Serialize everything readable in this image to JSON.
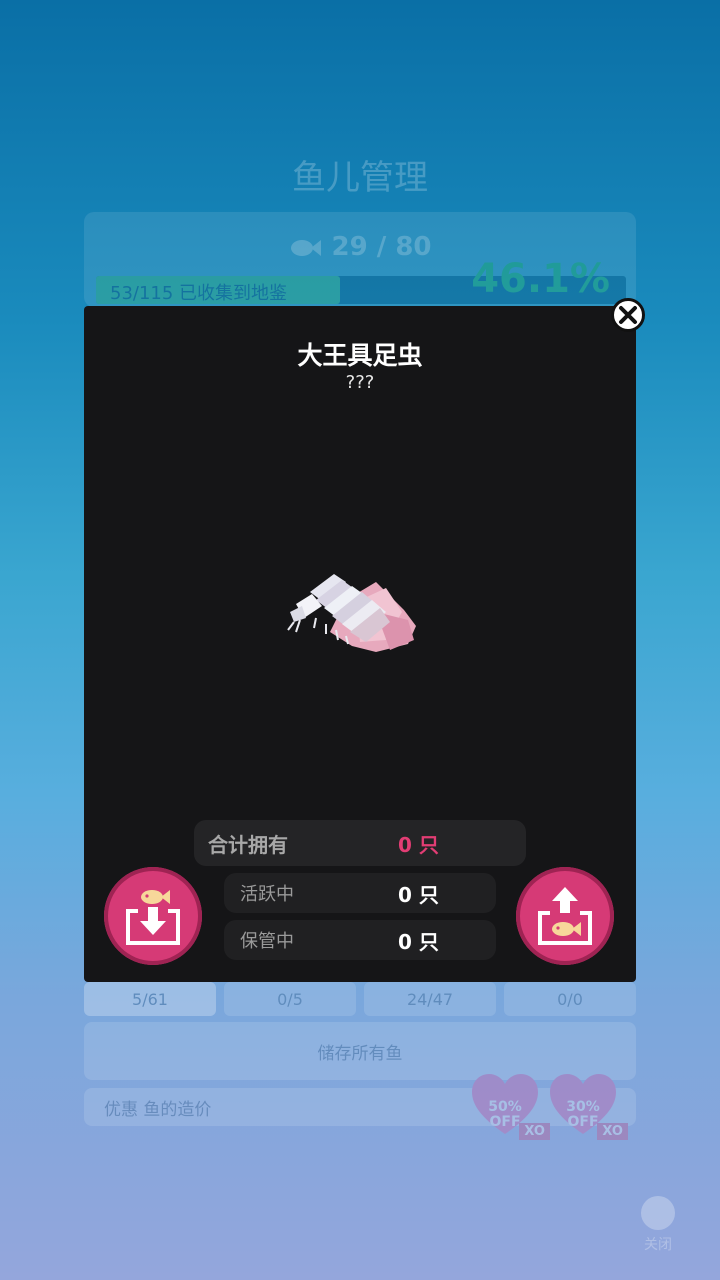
{
  "background": {
    "title": "鱼儿管理",
    "fish_count": "29 / 80",
    "progress_label": "53/115 已收集到地鉴",
    "progress_fraction": 0.461,
    "percent": "46.1%",
    "tabs": [
      {
        "label": "5/61",
        "active": true
      },
      {
        "label": "0/5",
        "active": false
      },
      {
        "label": "24/47",
        "active": false
      },
      {
        "label": "0/0",
        "active": false
      }
    ],
    "store_all": "储存所有鱼",
    "discount_label": "优惠 鱼的造价",
    "discount_badges": [
      {
        "text": "50%",
        "off": "OFF",
        "tag": "XO"
      },
      {
        "text": "30%",
        "off": "OFF",
        "tag": "XO"
      }
    ],
    "close_label": "关闭"
  },
  "modal": {
    "title": "大王具足虫",
    "subtitle": "???",
    "stats": {
      "total_label": "合计拥有",
      "total_value": "0 只",
      "active_label": "活跃中",
      "active_value": "0 只",
      "stored_label": "保管中",
      "stored_value": "0 只"
    }
  },
  "colors": {
    "accent_pink": "#d63a76",
    "total_value": "#e23d74",
    "modal_bg": "#151517"
  },
  "icons": {
    "close": "close-icon",
    "deposit": "fish-deposit-icon",
    "withdraw": "fish-withdraw-icon"
  }
}
